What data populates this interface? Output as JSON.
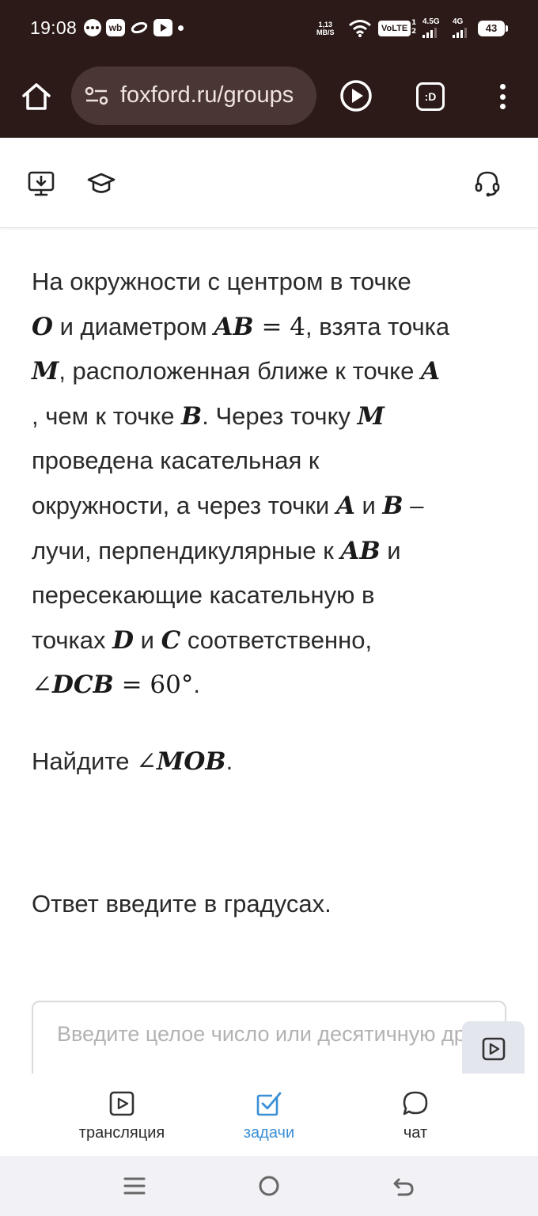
{
  "status_bar": {
    "time": "19:08",
    "wb_badge": "wb",
    "net_speed_top": "1,13",
    "net_speed_bottom": "MB/S",
    "volte": "VoLTE",
    "sim1_label": "1",
    "sim2_label": "2",
    "sig1_label": "4.5G",
    "sig2_label": "4G",
    "battery": "43"
  },
  "browser": {
    "url": "foxford.ru/groups",
    "tab_badge": ":D"
  },
  "problem": {
    "lines": [
      [
        {
          "t": "На окружности с центром в точке"
        }
      ],
      [
        {
          "m": "O"
        },
        {
          "t": " и диаметром "
        },
        {
          "m": "AB"
        },
        {
          "r": " = 4"
        },
        {
          "t": ", взята точка"
        }
      ],
      [
        {
          "m": "M"
        },
        {
          "t": ", расположенная ближе к точке "
        },
        {
          "m": "A"
        }
      ],
      [
        {
          "t": ", чем к точке "
        },
        {
          "m": "B"
        },
        {
          "t": ". Через точку "
        },
        {
          "m": "M"
        }
      ],
      [
        {
          "t": "проведена касательная к"
        }
      ],
      [
        {
          "t": "окружности, а через точки "
        },
        {
          "m": "A"
        },
        {
          "t": " и "
        },
        {
          "m": "B"
        },
        {
          "t": " –"
        }
      ],
      [
        {
          "t": "лучи, перпендикулярные к "
        },
        {
          "m": "AB"
        },
        {
          "t": " и"
        }
      ],
      [
        {
          "t": "пересекающие касательную в"
        }
      ],
      [
        {
          "t": "точках "
        },
        {
          "m": "D"
        },
        {
          "t": " и "
        },
        {
          "m": "C"
        },
        {
          "t": " соответственно,"
        }
      ],
      [
        {
          "r": "∠"
        },
        {
          "m": "DCB"
        },
        {
          "r": " = 60°"
        },
        {
          "t": "."
        }
      ]
    ],
    "find_prefix": "Найдите ",
    "find_angle_sign": "∠",
    "find_var": "MOB",
    "find_suffix": ".",
    "instruction": "Ответ введите в градусах."
  },
  "answer": {
    "placeholder": "Введите целое число или десятичную дробь",
    "value": ""
  },
  "bottom_nav": {
    "items": [
      {
        "label": "трансляция",
        "icon": "play-square-icon",
        "active": false
      },
      {
        "label": "задачи",
        "icon": "checkbox-icon",
        "active": true
      },
      {
        "label": "чат",
        "icon": "chat-bubble-icon",
        "active": false
      }
    ],
    "active_color": "#3a8fd6"
  },
  "colors": {
    "chrome_bg": "#2b1a17",
    "urlbar_bg": "#4a3733",
    "system_nav_bg": "#f2f2f6"
  }
}
